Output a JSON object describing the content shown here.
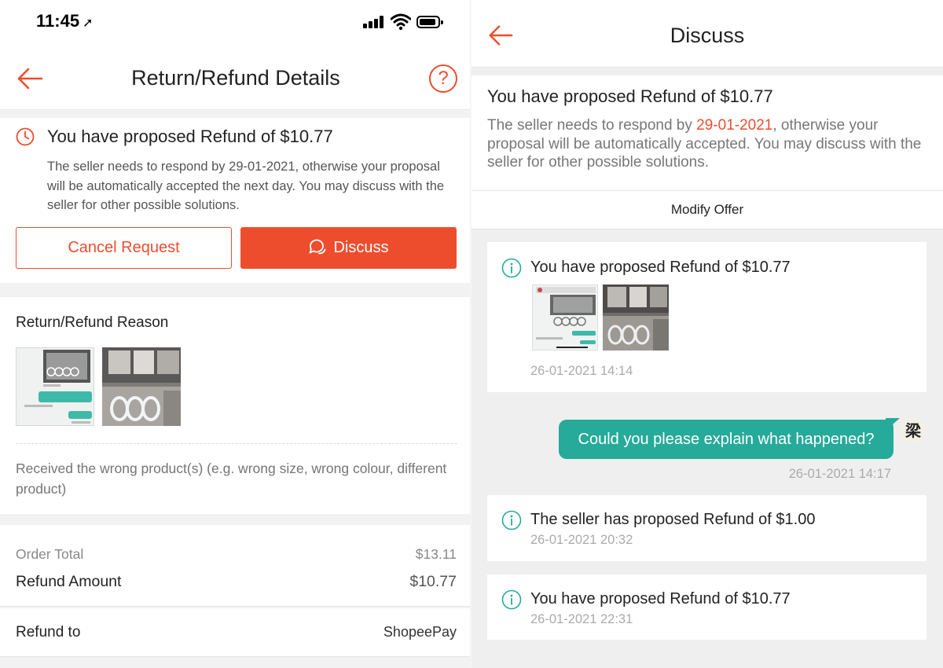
{
  "left": {
    "status_bar": {
      "time": "11:45"
    },
    "header": {
      "title": "Return/Refund Details",
      "help_symbol": "?"
    },
    "status": {
      "title": "You have proposed Refund of $10.77",
      "description": "The seller needs to respond by 29-01-2021, otherwise your proposal will be automatically accepted the next day. You may discuss with the seller for other possible solutions.",
      "cancel_label": "Cancel Request",
      "discuss_label": "Discuss"
    },
    "reason": {
      "title": "Return/Refund Reason",
      "text": "Received the wrong product(s) (e.g. wrong size, wrong colour, different product)"
    },
    "totals": {
      "order_total_label": "Order Total",
      "order_total_value": "$13.11",
      "refund_amount_label": "Refund Amount",
      "refund_amount_value": "$10.77"
    },
    "refund_to": {
      "label": "Refund to",
      "value": "ShopeePay"
    }
  },
  "right": {
    "header": {
      "title": "Discuss"
    },
    "status": {
      "title": "You have proposed Refund of $10.77",
      "desc_prefix": "The seller needs to respond by ",
      "desc_date": "29-01-2021",
      "desc_suffix": ", otherwise your proposal will be automatically accepted. You may discuss with the seller for other possible solutions."
    },
    "modify_offer_label": "Modify Offer",
    "messages": [
      {
        "title": "You have proposed Refund of $10.77",
        "time": "26-01-2021 14:14"
      },
      {
        "text": "Could you please explain what happened?",
        "time": "26-01-2021 14:17",
        "avatar": "梁"
      },
      {
        "title": "The seller has proposed Refund of $1.00",
        "time": "26-01-2021 20:32"
      },
      {
        "title": "You have proposed Refund of $10.77",
        "time": "26-01-2021 22:31"
      }
    ]
  },
  "colors": {
    "accent": "#ee4d2d",
    "teal": "#26aa99"
  }
}
